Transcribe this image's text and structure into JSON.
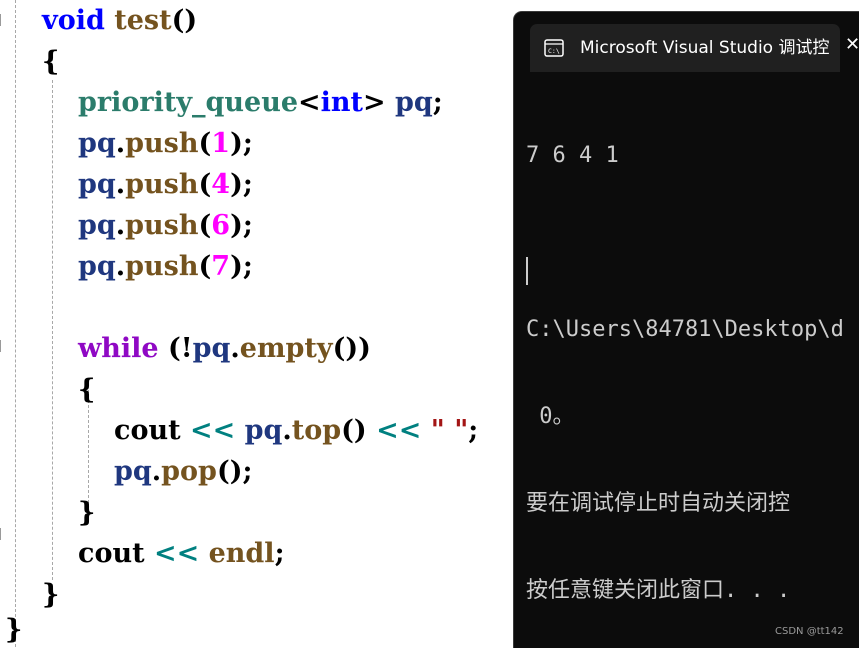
{
  "editor": {
    "lines": {
      "l1": {
        "kw": "void",
        "fn": "test",
        "p": "()"
      },
      "l2": {
        "p": "{"
      },
      "l3": {
        "type": "priority_queue",
        "lt": "<",
        "kw": "int",
        "gt": ">",
        "var": "pq",
        "semi": ";"
      },
      "l4": {
        "var": "pq",
        "dot": ".",
        "fn": "push",
        "po": "(",
        "num": "1",
        "pc": ");"
      },
      "l5": {
        "var": "pq",
        "dot": ".",
        "fn": "push",
        "po": "(",
        "num": "4",
        "pc": ");"
      },
      "l6": {
        "var": "pq",
        "dot": ".",
        "fn": "push",
        "po": "(",
        "num": "6",
        "pc": ");"
      },
      "l7": {
        "var": "pq",
        "dot": ".",
        "fn": "push",
        "po": "(",
        "num": "7",
        "pc": ");"
      },
      "l8": {
        "ctrl": "while",
        "open": " (!",
        "var": "pq",
        "dot": ".",
        "fn": "empty",
        "close": "())"
      },
      "l9": {
        "p": "{"
      },
      "l10": {
        "cout": "cout",
        "op1": " << ",
        "var": "pq",
        "dot": ".",
        "fn": "top",
        "paren": "()",
        "op2": " << ",
        "str": "\" \"",
        "semi": ";"
      },
      "l11": {
        "var": "pq",
        "dot": ".",
        "fn": "pop",
        "pc": "();"
      },
      "l12": {
        "p": "}"
      },
      "l13": {
        "cout": "cout",
        "op": " << ",
        "fn": "endl",
        "semi": ";"
      },
      "l14": {
        "p": "}"
      },
      "l15": {
        "p": "}"
      }
    }
  },
  "console": {
    "tab_title": "Microsoft Visual Studio 调试控",
    "tab_icon": "terminal-icon",
    "close_glyph": "✕",
    "output_lines": [
      "7 6 4 1",
      "",
      "C:\\Users\\84781\\Desktop\\d",
      " 0。",
      "要在调试停止时自动关闭控",
      "按任意键关闭此窗口. . ."
    ]
  },
  "watermark": "CSDN @tt142",
  "colors": {
    "keyword": "#0000ff",
    "function": "#74531f",
    "variable": "#1f377f",
    "type": "#2b7c6b",
    "number": "#ff00ff",
    "control": "#8f08c4",
    "operator": "#008080",
    "string": "#a31515",
    "console_bg": "#0c0c0c",
    "console_text": "#cccccc"
  }
}
